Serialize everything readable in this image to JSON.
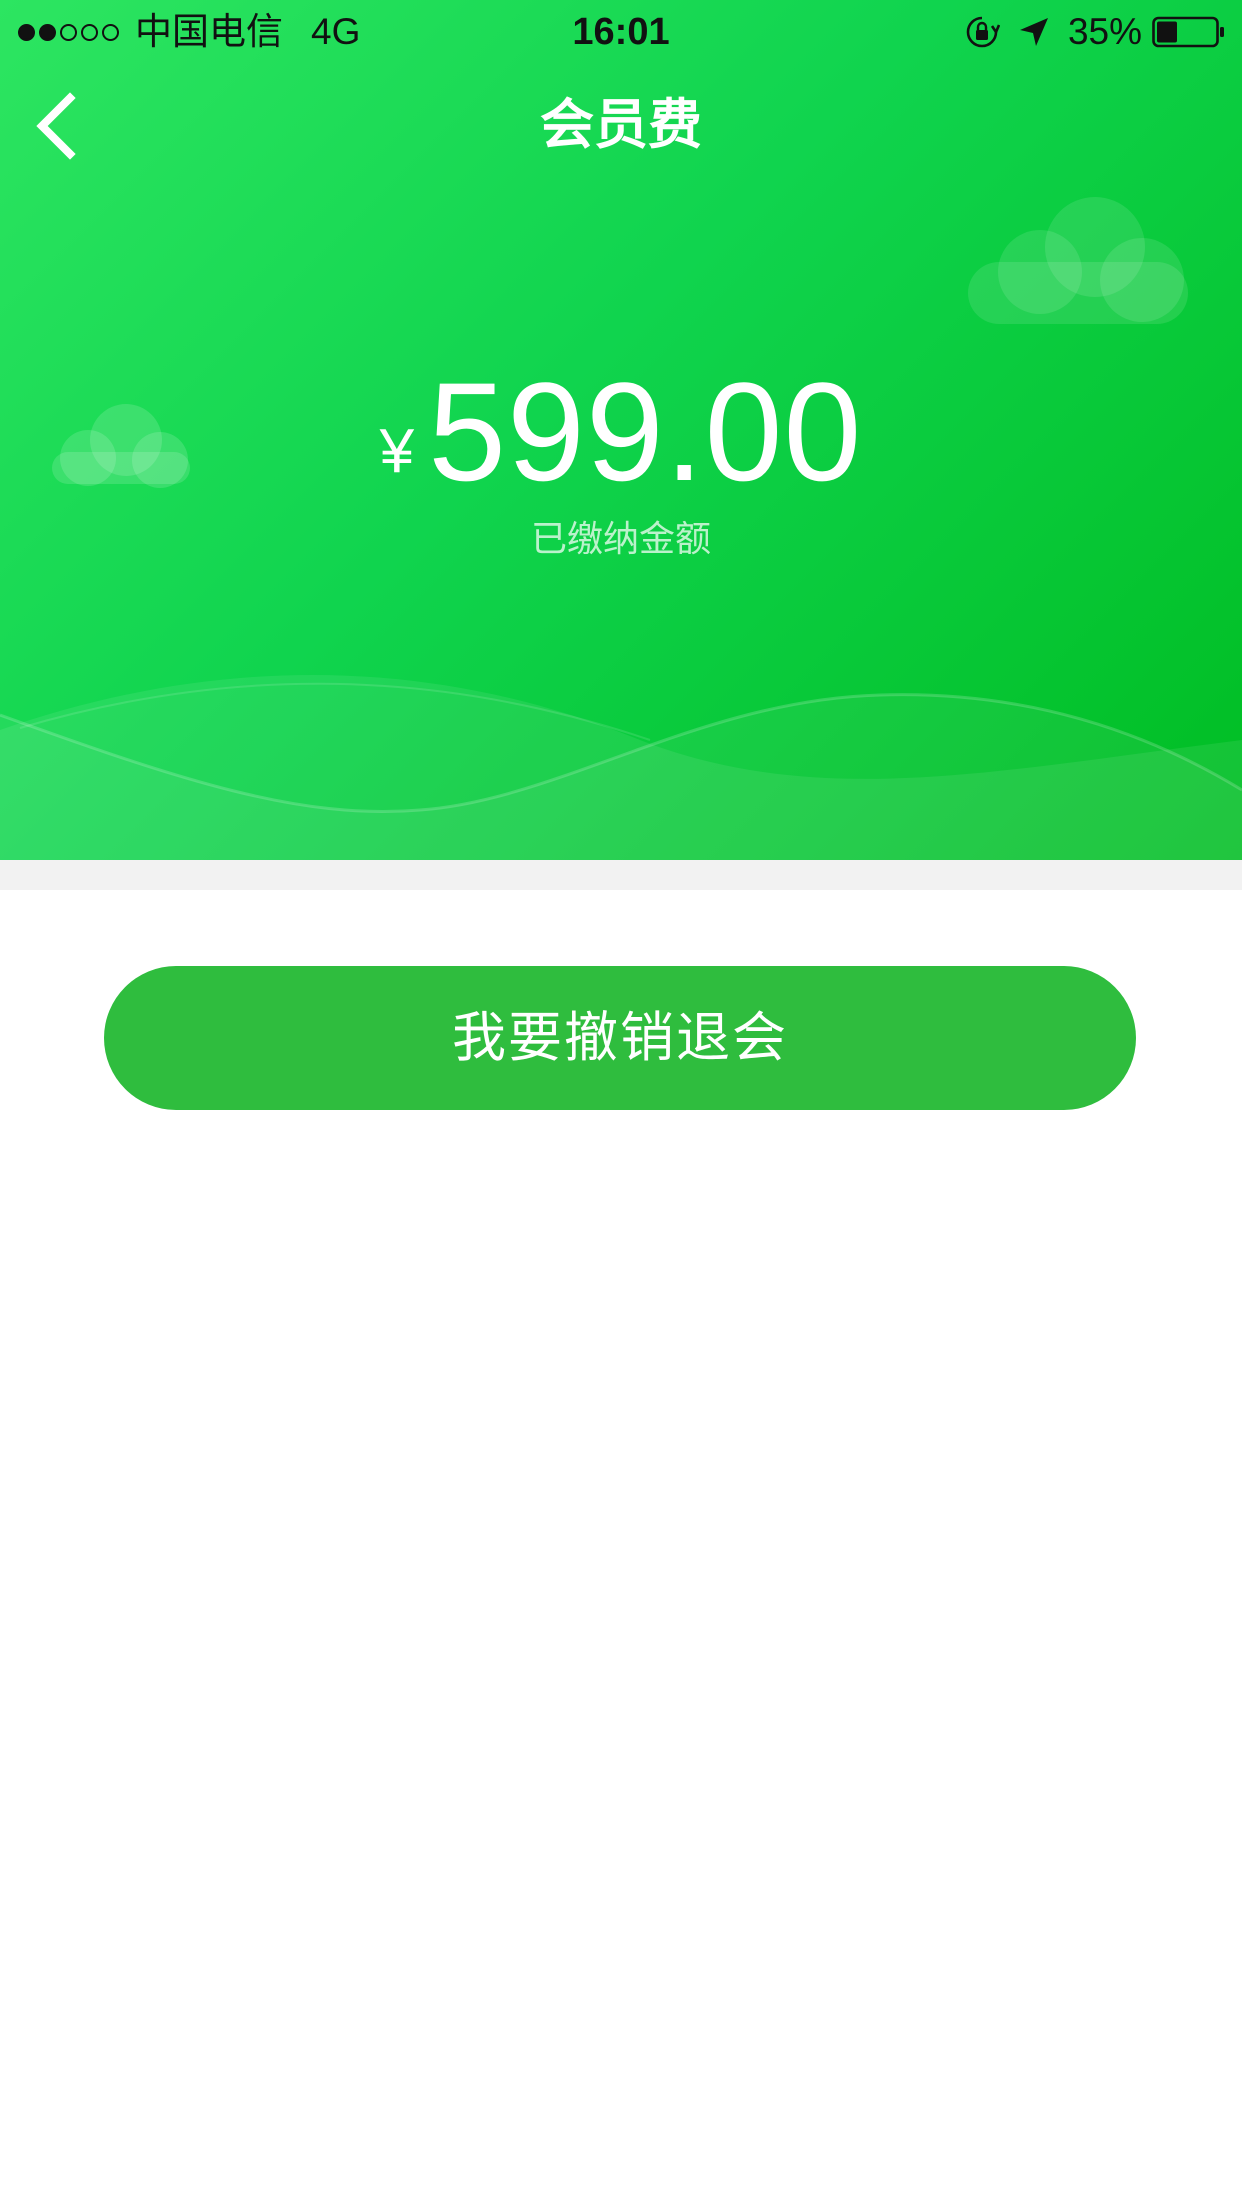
{
  "status_bar": {
    "carrier": "中国电信",
    "network": "4G",
    "time": "16:01",
    "battery_percent": "35%",
    "battery_level": 0.35,
    "signal_strength": 2,
    "signal_max": 5,
    "icons": [
      "orientation-lock-icon",
      "location-arrow-icon",
      "battery-icon"
    ]
  },
  "nav": {
    "title": "会员费",
    "back_icon": "chevron-left-icon"
  },
  "hero": {
    "currency_symbol": "¥",
    "amount": "599.00",
    "amount_label": "已缴纳金额"
  },
  "actions": {
    "cancel_label": "我要撤销退会"
  },
  "colors": {
    "hero_gradient_start": "#2de561",
    "hero_gradient_end": "#00bd22",
    "button": "#2fbd3e",
    "divider": "#f2f2f2",
    "text_on_green": "#ffffff"
  }
}
